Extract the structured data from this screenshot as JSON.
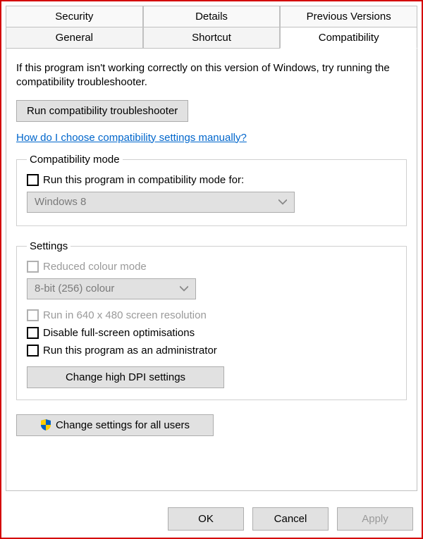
{
  "tabs": {
    "row1": [
      "Security",
      "Details",
      "Previous Versions"
    ],
    "row2": [
      "General",
      "Shortcut",
      "Compatibility"
    ],
    "activeIndex": 2
  },
  "intro": "If this program isn't working correctly on this version of Windows, try running the compatibility troubleshooter.",
  "buttons": {
    "troubleshooter": "Run compatibility troubleshooter",
    "dpi": "Change high DPI settings",
    "allusers": "Change settings for all users",
    "ok": "OK",
    "cancel": "Cancel",
    "apply": "Apply"
  },
  "link": "How do I choose compatibility settings manually?",
  "compat": {
    "legend": "Compatibility mode",
    "checkbox": "Run this program in compatibility mode for:",
    "os": "Windows 8"
  },
  "settings": {
    "legend": "Settings",
    "reduced": "Reduced colour mode",
    "colour": "8-bit (256) colour",
    "lowres": "Run in 640 x 480 screen resolution",
    "disable_fs": "Disable full-screen optimisations",
    "admin": "Run this program as an administrator"
  }
}
